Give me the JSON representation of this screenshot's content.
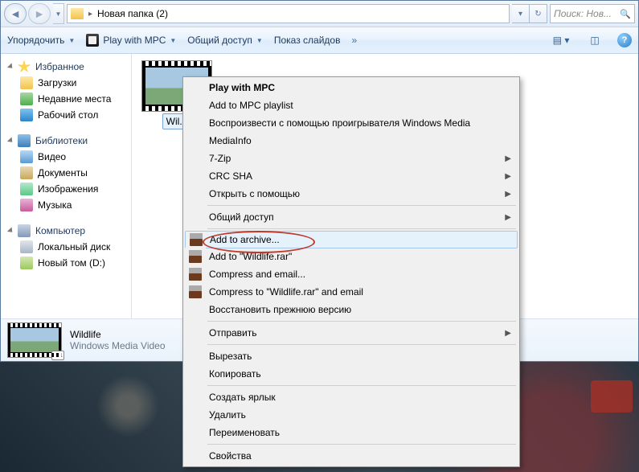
{
  "address": {
    "folder_name": "Новая папка (2)"
  },
  "search": {
    "placeholder": "Поиск: Нов..."
  },
  "toolbar": {
    "organize": "Упорядочить",
    "play_mpc": "Play with MPC",
    "share": "Общий доступ",
    "slideshow": "Показ слайдов"
  },
  "sidebar": {
    "favorites": {
      "header": "Избранное",
      "items": [
        "Загрузки",
        "Недавние места",
        "Рабочий стол"
      ]
    },
    "libraries": {
      "header": "Библиотеки",
      "items": [
        "Видео",
        "Документы",
        "Изображения",
        "Музыка"
      ]
    },
    "computer": {
      "header": "Компьютер",
      "items": [
        "Локальный диск",
        "Новый том (D:)"
      ]
    }
  },
  "file": {
    "thumb_label": "Wil..."
  },
  "details": {
    "name": "Wildlife",
    "type": "Windows Media Video"
  },
  "context_menu": {
    "play_mpc": "Play with MPC",
    "add_playlist": "Add to MPC playlist",
    "play_wmp": "Воспроизвести с помощью проигрывателя Windows Media",
    "mediainfo": "MediaInfo",
    "sevenzip": "7-Zip",
    "crc": "CRC SHA",
    "open_with": "Открыть с помощью",
    "share": "Общий доступ",
    "add_archive": "Add to archive...",
    "add_rar": "Add to \"Wildlife.rar\"",
    "compress_email": "Compress and email...",
    "compress_rar_email": "Compress to \"Wildlife.rar\" and email",
    "restore": "Восстановить прежнюю версию",
    "send_to": "Отправить",
    "cut": "Вырезать",
    "copy": "Копировать",
    "shortcut": "Создать ярлык",
    "delete": "Удалить",
    "rename": "Переименовать",
    "properties": "Свойства"
  }
}
